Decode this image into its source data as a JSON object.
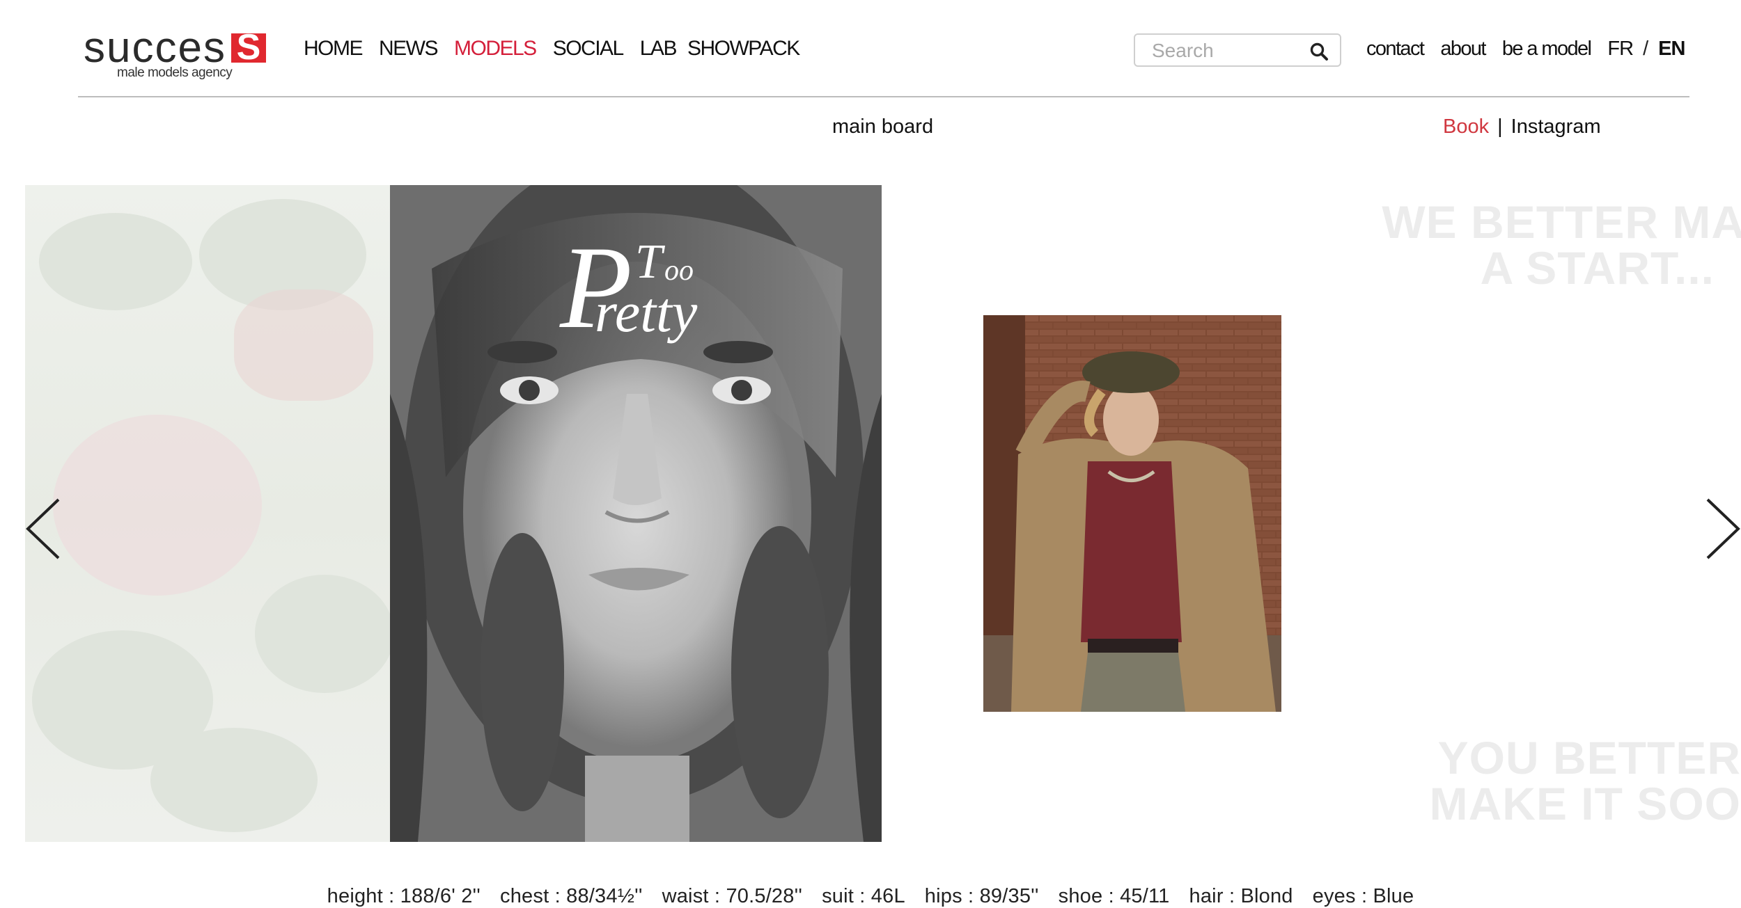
{
  "brand": {
    "name": "succes",
    "mark": "S",
    "tagline": "male models agency"
  },
  "nav": [
    {
      "label": "HOME",
      "active": false
    },
    {
      "label": "NEWS",
      "active": false
    },
    {
      "label": "MODELS",
      "active": true
    },
    {
      "label": "SOCIAL",
      "active": false
    },
    {
      "label": "LAB",
      "active": false
    },
    {
      "label": "SHOWPACK",
      "active": false
    }
  ],
  "search": {
    "placeholder": "Search",
    "value": "",
    "icon": "search-icon"
  },
  "util_links": {
    "contact": "contact",
    "about": "about",
    "be_a_model": "be a model"
  },
  "lang": {
    "fr": "FR",
    "separator": "/",
    "en": "EN",
    "selected": "EN"
  },
  "board": {
    "label": "main board"
  },
  "profile_links": {
    "book": "Book",
    "separator": "|",
    "instagram": "Instagram",
    "active": "Book"
  },
  "cover": {
    "magazine": {
      "P": "P",
      "retty": "retty",
      "T": "T",
      "oo": "oo"
    }
  },
  "ghost_text": {
    "top_line1": "WE BETTER MA",
    "top_line2": "A START...",
    "bottom_line1": "YOU BETTER",
    "bottom_line2": "MAKE IT SOO"
  },
  "carousel": {
    "prev_icon": "chevron-left-icon",
    "next_icon": "chevron-right-icon"
  },
  "measurements": [
    {
      "label": "height",
      "value": "188/6' 2''"
    },
    {
      "label": "chest",
      "value": "88/34½''"
    },
    {
      "label": "waist",
      "value": "70.5/28''"
    },
    {
      "label": "suit",
      "value": "46L"
    },
    {
      "label": "hips",
      "value": "89/35''"
    },
    {
      "label": "shoe",
      "value": "45/11"
    },
    {
      "label": "hair",
      "value": "Blond"
    },
    {
      "label": "eyes",
      "value": "Blue"
    }
  ],
  "colors": {
    "accent": "#d41f3a",
    "rule": "#bdbdbd",
    "text": "#111111"
  }
}
